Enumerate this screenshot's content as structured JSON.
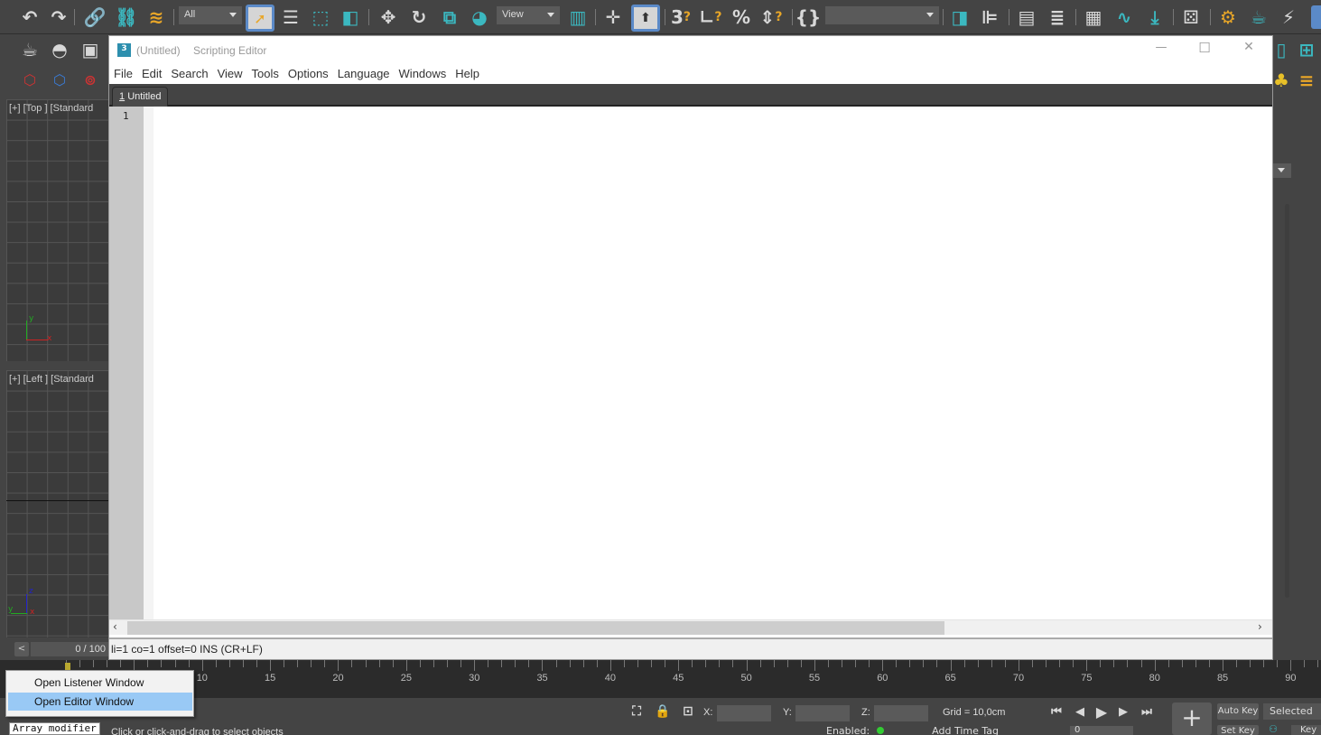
{
  "toolbar": {
    "selection_filter": "All",
    "ref_coord": "View",
    "named_selection": "",
    "icons": [
      "undo-icon",
      "redo-icon",
      "link-icon",
      "unlink-icon",
      "bind-spacewarp-icon",
      "select-object-icon",
      "select-by-name-icon",
      "rect-selection-icon",
      "window-crossing-icon",
      "move-icon",
      "rotate-icon",
      "scale-icon",
      "select-manipulate-icon",
      "use-pivot-icon",
      "keyboard-shortcut-override-icon",
      "snaps-toggle-icon",
      "angle-snap-icon",
      "percent-snap-icon",
      "spinner-snap-icon",
      "edit-named-selection-icon",
      "mirror-icon",
      "align-icon",
      "scene-explorer-icon",
      "layer-explorer-icon",
      "toggle-ribbon-icon",
      "curve-editor-icon",
      "schematic-view-icon",
      "material-editor-icon",
      "render-setup-icon",
      "rendered-frame-icon",
      "render-icon"
    ]
  },
  "left_panel": {
    "create_icons": [
      "teapot-icon",
      "sphere-icon",
      "box-icon"
    ],
    "fx_icons": [
      "fire-cube-icon",
      "water-cube-icon",
      "flame-icon"
    ]
  },
  "viewports": {
    "top_label": "[+] [Top ] [Standard",
    "left_label": "[+] [Left ] [Standard",
    "top_axes": {
      "y": "y",
      "x": "x"
    },
    "left_axes": {
      "z": "z",
      "y": "y",
      "x": "x"
    }
  },
  "editor": {
    "title_app": "(Untitled)",
    "title_name": "Scripting Editor",
    "app_icon_label": "3",
    "menu": [
      "File",
      "Edit",
      "Search",
      "View",
      "Tools",
      "Options",
      "Language",
      "Windows",
      "Help"
    ],
    "tab": {
      "number": "1",
      "label": "Untitled"
    },
    "line_numbers": [
      "1"
    ],
    "content": "",
    "status": "li=1 co=1 offset=0 INS (CR+LF)",
    "window_buttons": {
      "minimize": "—",
      "maximize": "☐",
      "close": "✕"
    }
  },
  "timeline": {
    "frame_counter": "0 / 100",
    "prev_label": "<",
    "ruler_ticks": [
      "10",
      "15",
      "20",
      "25",
      "30",
      "35",
      "40",
      "45",
      "50",
      "55",
      "60",
      "65",
      "70",
      "75",
      "80",
      "85",
      "90"
    ]
  },
  "context_menu": {
    "items": [
      {
        "label": "Open Listener Window",
        "highlighted": false
      },
      {
        "label": "Open Editor Window",
        "highlighted": true
      }
    ]
  },
  "bottom_bar": {
    "maxscript_listener": "Array modifier",
    "prompt": "Click or click-and-drag to select objects",
    "x_label": "X:",
    "y_label": "Y:",
    "z_label": "Z:",
    "x_value": "",
    "y_value": "",
    "z_value": "",
    "grid": "Grid = 10,0cm",
    "auto_key": "Auto Key",
    "set_key": "Set Key",
    "key_filter": "Selected",
    "key_filters_label": "Key",
    "enabled_label": "Enabled:",
    "add_time_tag": "Add Time Tag",
    "current_frame": "0"
  },
  "colors": {
    "ui_bg": "#444444",
    "accent": "#5b8ac8",
    "teal": "#3bb8c0",
    "highlight": "#99c9f5"
  }
}
